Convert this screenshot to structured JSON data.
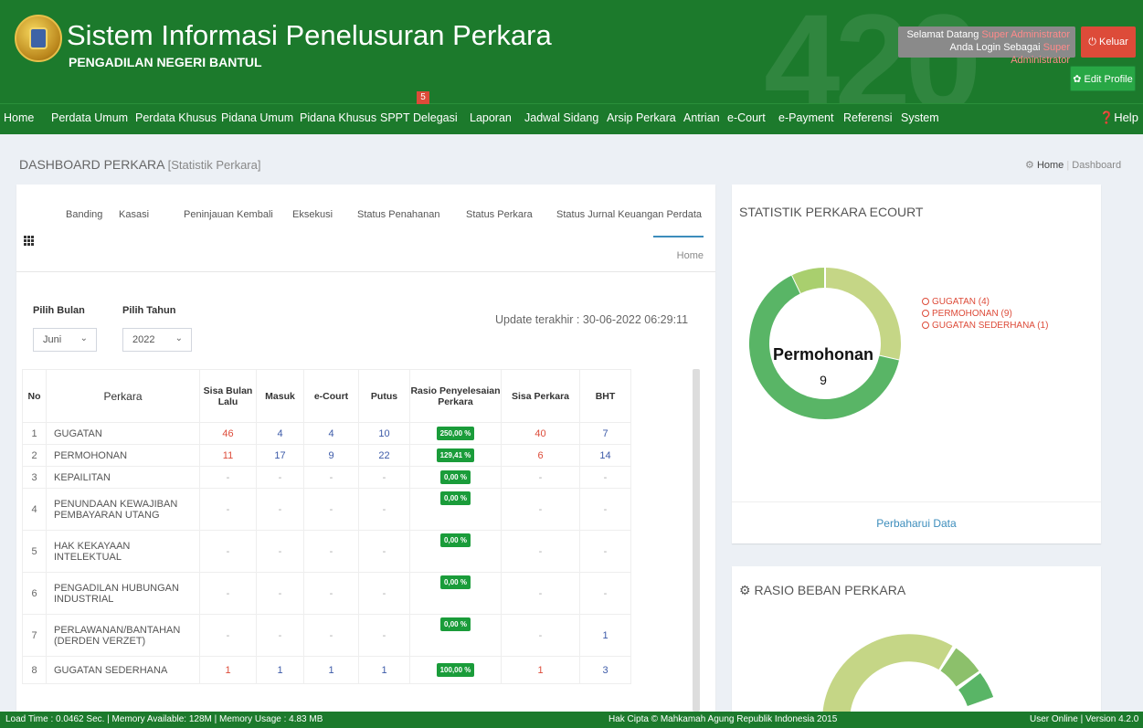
{
  "header": {
    "title": "Sistem Informasi Penelusuran Perkara",
    "subtitle": "PENGADILAN NEGERI BANTUL",
    "watermark": "420",
    "welcome_line1": "Selamat Datang",
    "welcome_line2": "Anda Login Sebagai",
    "user_name": "Super Administrator",
    "user_role": "Super Administrator",
    "logout_label": "Keluar",
    "edit_profile_label": "Edit Profile"
  },
  "nav": {
    "items": [
      "Home",
      "Perdata Umum",
      "Perdata Khusus",
      "Pidana Umum",
      "Pidana Khusus",
      "SPPT",
      "Delegasi",
      "Laporan",
      "Jadwal Sidang",
      "Arsip Perkara",
      "Antrian",
      "e-Court",
      "e-Payment",
      "Referensi",
      "System"
    ],
    "badge": "5",
    "help_label": "Help"
  },
  "page": {
    "title": "DASHBOARD PERKARA",
    "subtitle": "[Statistik Perkara]",
    "breadcrumb_home": "Home",
    "breadcrumb_current": "Dashboard"
  },
  "tabs": {
    "items": [
      "Banding",
      "Kasasi",
      "Peninjauan Kembali",
      "Eksekusi",
      "Status Penahanan",
      "Status Perkara",
      "Status Jurnal Keuangan Perdata"
    ],
    "active": "Home"
  },
  "filters": {
    "bulan_label": "Pilih Bulan",
    "bulan_value": "Juni",
    "tahun_label": "Pilih Tahun",
    "tahun_value": "2022",
    "update_text": "Update terakhir : 30-06-2022 06:29:11"
  },
  "table": {
    "headers": [
      "No",
      "Perkara",
      "Sisa Bulan Lalu",
      "Masuk",
      "e-Court",
      "Putus",
      "Rasio Penyelesaian Perkara",
      "Sisa Perkara",
      "BHT"
    ],
    "rows": [
      {
        "no": "1",
        "perkara": "GUGATAN",
        "sisa_lalu": "46",
        "masuk": "4",
        "ecourt": "4",
        "putus": "10",
        "rasio": "250,00 %",
        "sisa": "40",
        "bht": "7"
      },
      {
        "no": "2",
        "perkara": "PERMOHONAN",
        "sisa_lalu": "11",
        "masuk": "17",
        "ecourt": "9",
        "putus": "22",
        "rasio": "129,41 %",
        "sisa": "6",
        "bht": "14"
      },
      {
        "no": "3",
        "perkara": "KEPAILITAN",
        "sisa_lalu": "-",
        "masuk": "-",
        "ecourt": "-",
        "putus": "-",
        "rasio": "0,00 %",
        "sisa": "-",
        "bht": "-"
      },
      {
        "no": "4",
        "perkara": "PENUNDAAN KEWAJIBAN PEMBAYARAN UTANG",
        "sisa_lalu": "-",
        "masuk": "-",
        "ecourt": "-",
        "putus": "-",
        "rasio": "0,00 %",
        "sisa": "-",
        "bht": "-"
      },
      {
        "no": "5",
        "perkara": "HAK KEKAYAAN INTELEKTUAL",
        "sisa_lalu": "-",
        "masuk": "-",
        "ecourt": "-",
        "putus": "-",
        "rasio": "0,00 %",
        "sisa": "-",
        "bht": "-"
      },
      {
        "no": "6",
        "perkara": "PENGADILAN HUBUNGAN INDUSTRIAL",
        "sisa_lalu": "-",
        "masuk": "-",
        "ecourt": "-",
        "putus": "-",
        "rasio": "0,00 %",
        "sisa": "-",
        "bht": "-"
      },
      {
        "no": "7",
        "perkara": "PERLAWANAN/BANTAHAN (DERDEN VERZET)",
        "sisa_lalu": "-",
        "masuk": "-",
        "ecourt": "-",
        "putus": "-",
        "rasio": "0,00 %",
        "sisa": "-",
        "bht": "1"
      },
      {
        "no": "8",
        "perkara": "GUGATAN SEDERHANA",
        "sisa_lalu": "1",
        "masuk": "1",
        "ecourt": "1",
        "putus": "1",
        "rasio": "100,00 %",
        "sisa": "1",
        "bht": "3"
      }
    ]
  },
  "ecourt": {
    "title": "STATISTIK PERKARA ECOURT",
    "center_label": "Permohonan",
    "center_value": "9",
    "legend": [
      "GUGATAN (4)",
      "PERMOHONAN (9)",
      "GUGATAN SEDERHANA (1)"
    ],
    "values": [
      4,
      9,
      1
    ],
    "colors": [
      "#c5d686",
      "#59b566",
      "#a9cf6e"
    ],
    "refresh_label": "Perbaharui Data"
  },
  "rasio": {
    "title": "RASIO BEBAN PERKARA"
  },
  "footer": {
    "left": "Load Time : 0.0462 Sec. | Memory Available: 128M | Memory Usage : 4.83 MB",
    "center": "Hak Cipta © Mahkamah Agung Republik Indonesia 2015",
    "right": "User Online | Version 4.2.0"
  },
  "colors": {
    "brand_green": "#1c7a2c",
    "danger_red": "#dd4b39",
    "ratio_green": "#1a9c3a",
    "link_blue": "#3c8dbc"
  }
}
